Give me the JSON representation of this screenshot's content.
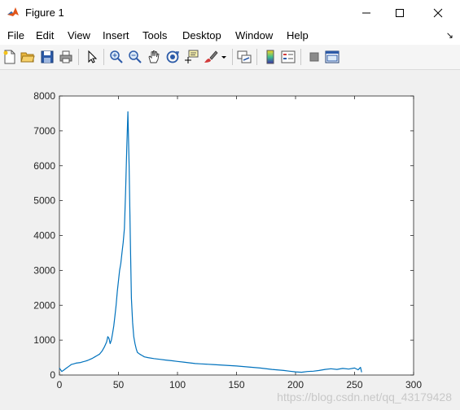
{
  "window": {
    "title": "Figure 1"
  },
  "menu": {
    "items": [
      "File",
      "Edit",
      "View",
      "Insert",
      "Tools",
      "Desktop",
      "Window",
      "Help"
    ],
    "overflow_arrow": "↘"
  },
  "toolbar": {
    "icons": [
      "new-figure-icon",
      "open-icon",
      "save-icon",
      "print-icon",
      "pointer-icon",
      "zoom-in-icon",
      "zoom-out-icon",
      "pan-icon",
      "rotate-3d-icon",
      "data-cursor-icon",
      "brush-icon",
      "brush-dropdown-icon",
      "link-plot-icon",
      "colorbar-icon",
      "legend-icon",
      "hide-plot-tools-icon",
      "show-plot-tools-icon"
    ]
  },
  "watermark": "https://blog.csdn.net/qq_43179428",
  "colors": {
    "line": "#0072bd",
    "axes_bg": "#ffffff",
    "figure_bg": "#f0f0f0"
  },
  "chart_data": {
    "type": "line",
    "xlim": [
      0,
      300
    ],
    "ylim": [
      0,
      8000
    ],
    "xticks": [
      0,
      50,
      100,
      150,
      200,
      250,
      300
    ],
    "yticks": [
      0,
      1000,
      2000,
      3000,
      4000,
      5000,
      6000,
      7000,
      8000
    ],
    "grid": false,
    "series": [
      {
        "x": [
          0,
          2,
          4,
          6,
          8,
          10,
          12,
          14,
          16,
          18,
          20,
          22,
          24,
          26,
          28,
          30,
          32,
          34,
          36,
          38,
          40,
          41,
          42,
          43,
          44,
          45,
          46,
          47,
          48,
          49,
          50,
          51,
          52,
          53,
          54,
          55,
          56,
          57,
          58,
          59,
          60,
          61,
          62,
          63,
          64,
          65,
          66,
          68,
          70,
          72,
          75,
          80,
          85,
          90,
          95,
          100,
          105,
          110,
          115,
          120,
          130,
          140,
          150,
          160,
          170,
          180,
          190,
          195,
          200,
          205,
          210,
          215,
          220,
          225,
          230,
          235,
          240,
          245,
          250,
          253,
          255,
          256
        ],
        "y": [
          200,
          100,
          150,
          200,
          250,
          300,
          320,
          340,
          350,
          360,
          380,
          400,
          420,
          450,
          480,
          520,
          560,
          600,
          680,
          800,
          950,
          1100,
          1050,
          900,
          1000,
          1200,
          1400,
          1700,
          2000,
          2400,
          2700,
          3000,
          3200,
          3500,
          3800,
          4200,
          5200,
          6500,
          7550,
          6000,
          4000,
          2200,
          1500,
          1100,
          900,
          750,
          650,
          600,
          560,
          520,
          500,
          470,
          450,
          430,
          410,
          390,
          370,
          350,
          330,
          320,
          300,
          280,
          260,
          230,
          200,
          160,
          130,
          110,
          90,
          80,
          100,
          110,
          130,
          160,
          180,
          160,
          190,
          170,
          200,
          150,
          220,
          80
        ]
      }
    ]
  }
}
